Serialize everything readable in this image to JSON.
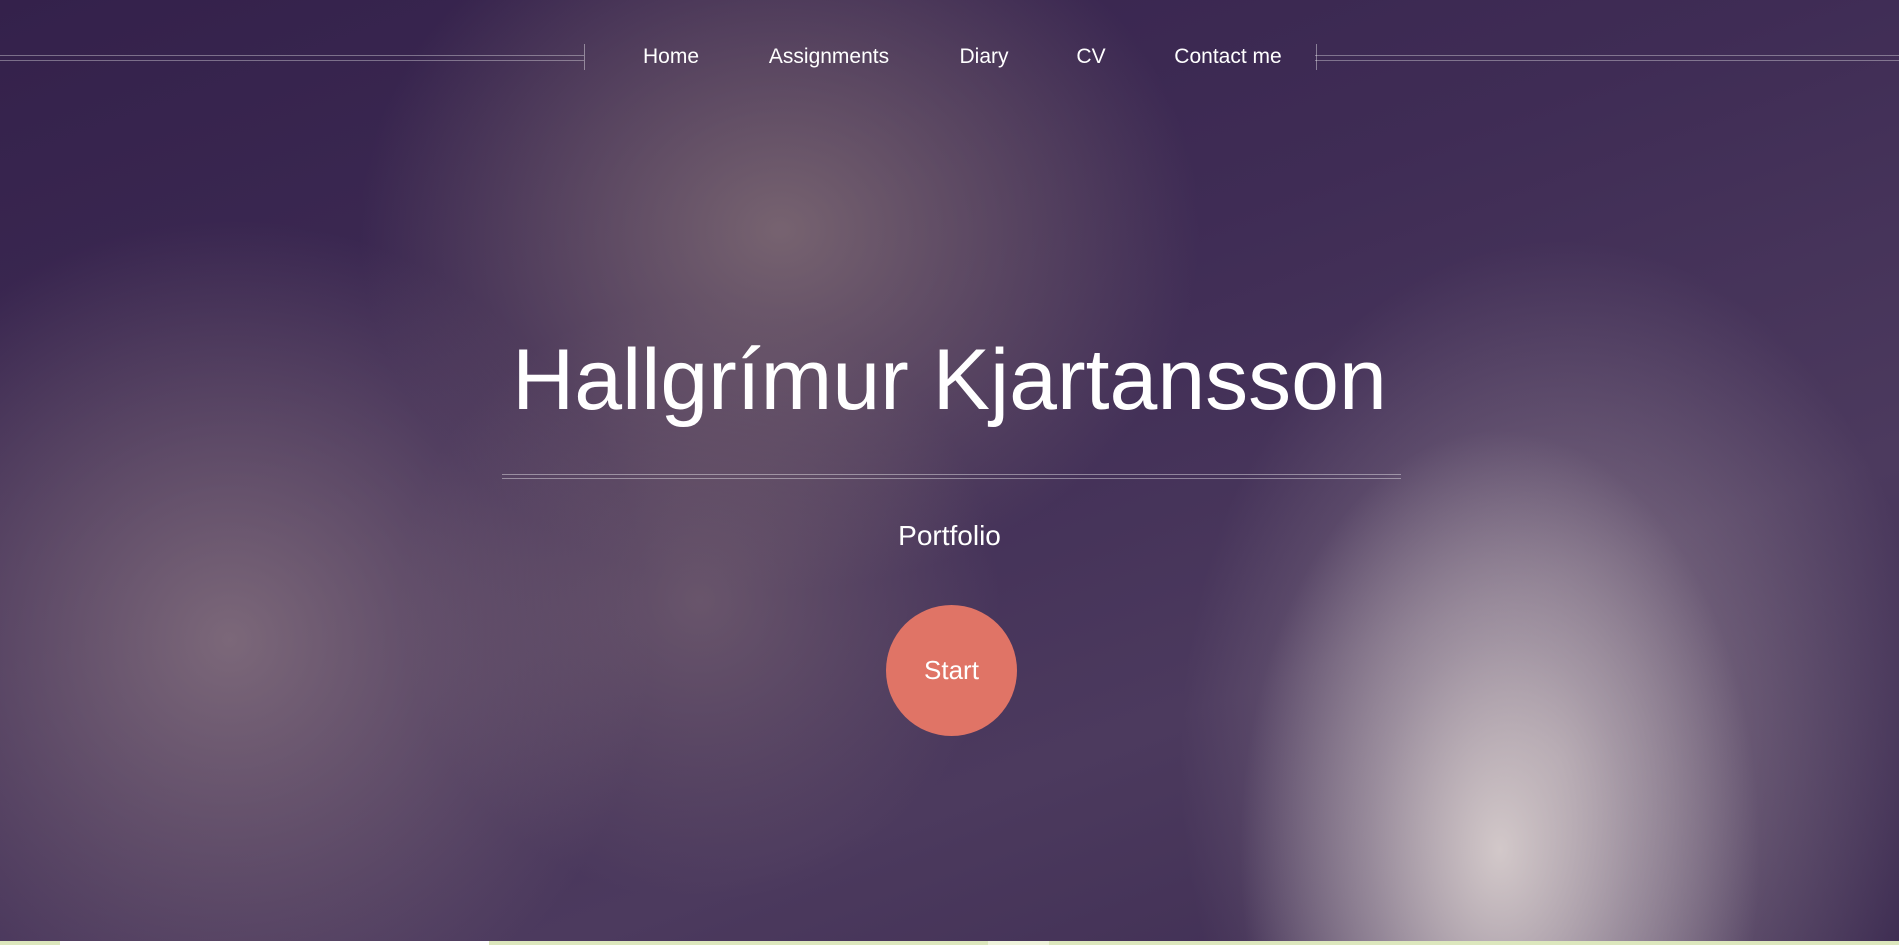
{
  "nav": {
    "items": [
      "Home",
      "Assignments",
      "Diary",
      "CV",
      "Contact me"
    ]
  },
  "hero": {
    "title": "Hallgrímur Kjartansson",
    "subtitle": "Portfolio",
    "start_label": "Start"
  },
  "colors": {
    "accent": "#e07466",
    "background": "#3a2850"
  }
}
